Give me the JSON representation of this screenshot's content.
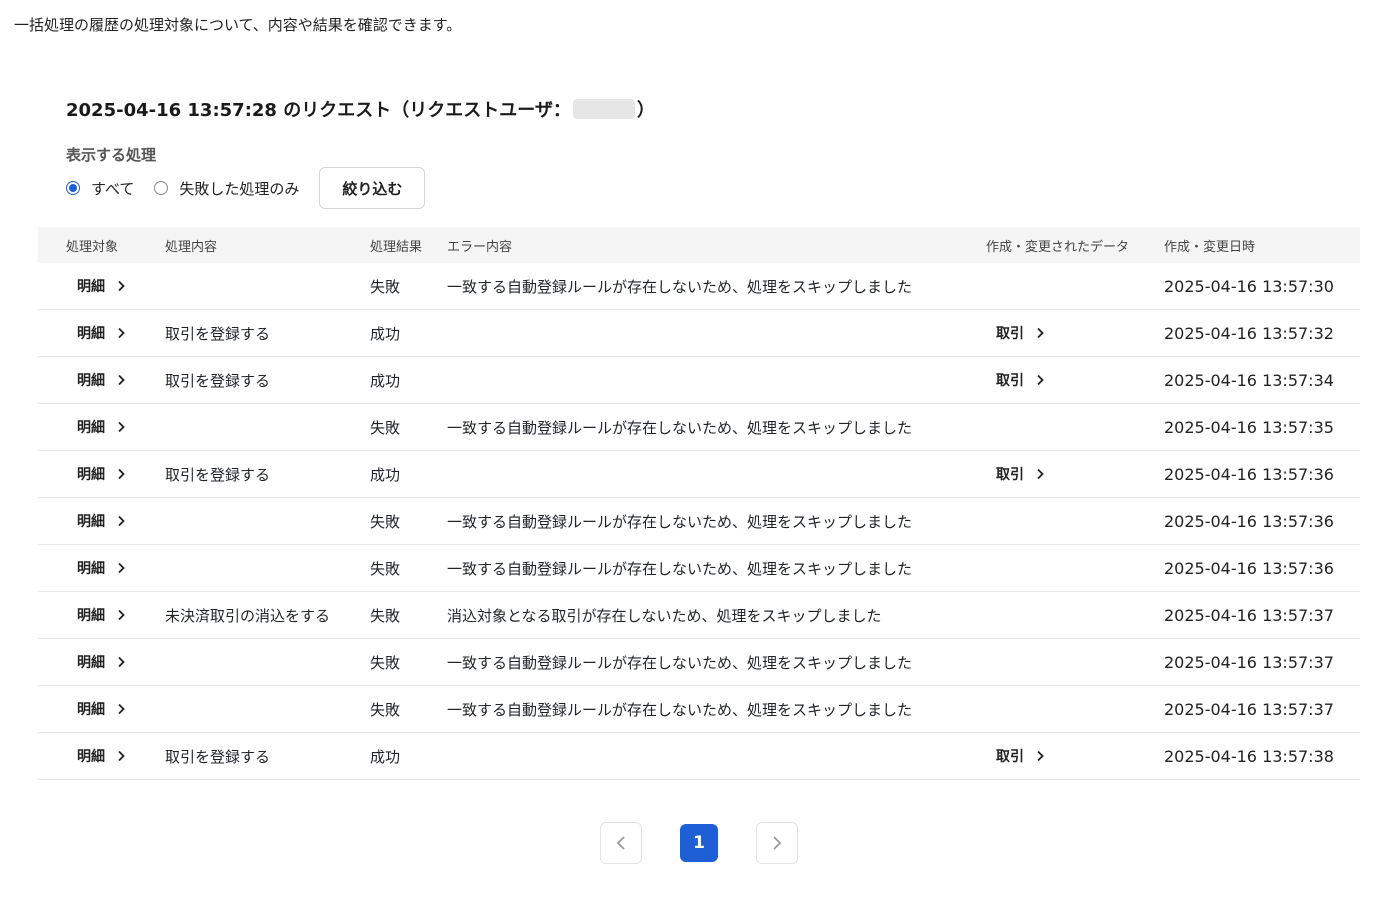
{
  "intro_text": "一括処理の履歴の処理対象について、内容や結果を確認できます。",
  "request": {
    "title_prefix": "2025-04-16 13:57:28 のリクエスト（リクエストユーザ：",
    "title_suffix": "）"
  },
  "filter": {
    "label": "表示する処理",
    "options": [
      {
        "label": "すべて",
        "checked": true
      },
      {
        "label": "失敗した処理のみ",
        "checked": false
      }
    ],
    "button_label": "絞り込む"
  },
  "table": {
    "headers": [
      "処理対象",
      "処理内容",
      "処理結果",
      "エラー内容",
      "作成・変更されたデータ",
      "作成・変更日時"
    ],
    "rows": [
      {
        "target": "明細",
        "content": "",
        "result": "失敗",
        "error": "一致する自動登録ルールが存在しないため、処理をスキップしました",
        "data": "",
        "datetime": "2025-04-16 13:57:30"
      },
      {
        "target": "明細",
        "content": "取引を登録する",
        "result": "成功",
        "error": "",
        "data": "取引",
        "datetime": "2025-04-16 13:57:32"
      },
      {
        "target": "明細",
        "content": "取引を登録する",
        "result": "成功",
        "error": "",
        "data": "取引",
        "datetime": "2025-04-16 13:57:34"
      },
      {
        "target": "明細",
        "content": "",
        "result": "失敗",
        "error": "一致する自動登録ルールが存在しないため、処理をスキップしました",
        "data": "",
        "datetime": "2025-04-16 13:57:35"
      },
      {
        "target": "明細",
        "content": "取引を登録する",
        "result": "成功",
        "error": "",
        "data": "取引",
        "datetime": "2025-04-16 13:57:36"
      },
      {
        "target": "明細",
        "content": "",
        "result": "失敗",
        "error": "一致する自動登録ルールが存在しないため、処理をスキップしました",
        "data": "",
        "datetime": "2025-04-16 13:57:36"
      },
      {
        "target": "明細",
        "content": "",
        "result": "失敗",
        "error": "一致する自動登録ルールが存在しないため、処理をスキップしました",
        "data": "",
        "datetime": "2025-04-16 13:57:36"
      },
      {
        "target": "明細",
        "content": "未決済取引の消込をする",
        "result": "失敗",
        "error": "消込対象となる取引が存在しないため、処理をスキップしました",
        "data": "",
        "datetime": "2025-04-16 13:57:37"
      },
      {
        "target": "明細",
        "content": "",
        "result": "失敗",
        "error": "一致する自動登録ルールが存在しないため、処理をスキップしました",
        "data": "",
        "datetime": "2025-04-16 13:57:37"
      },
      {
        "target": "明細",
        "content": "",
        "result": "失敗",
        "error": "一致する自動登録ルールが存在しないため、処理をスキップしました",
        "data": "",
        "datetime": "2025-04-16 13:57:37"
      },
      {
        "target": "明細",
        "content": "取引を登録する",
        "result": "成功",
        "error": "",
        "data": "取引",
        "datetime": "2025-04-16 13:57:38"
      }
    ]
  },
  "pagination": {
    "current_page": "1"
  },
  "colors": {
    "accent": "#1e5fd6",
    "header_bg": "#f5f5f5"
  }
}
